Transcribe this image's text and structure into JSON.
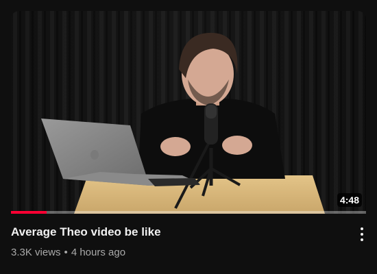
{
  "video": {
    "title": "Average Theo video be like",
    "views": "3.3K views",
    "separator": "•",
    "age": "4 hours ago",
    "duration": "4:48",
    "watched_fraction": 0.1
  },
  "colors": {
    "background": "#0f0f0f",
    "title_text": "#f1f1f1",
    "secondary_text": "#aaaaaa",
    "progress_red": "#ff0033"
  },
  "icons": {
    "more_actions": "more-vertical-icon"
  }
}
